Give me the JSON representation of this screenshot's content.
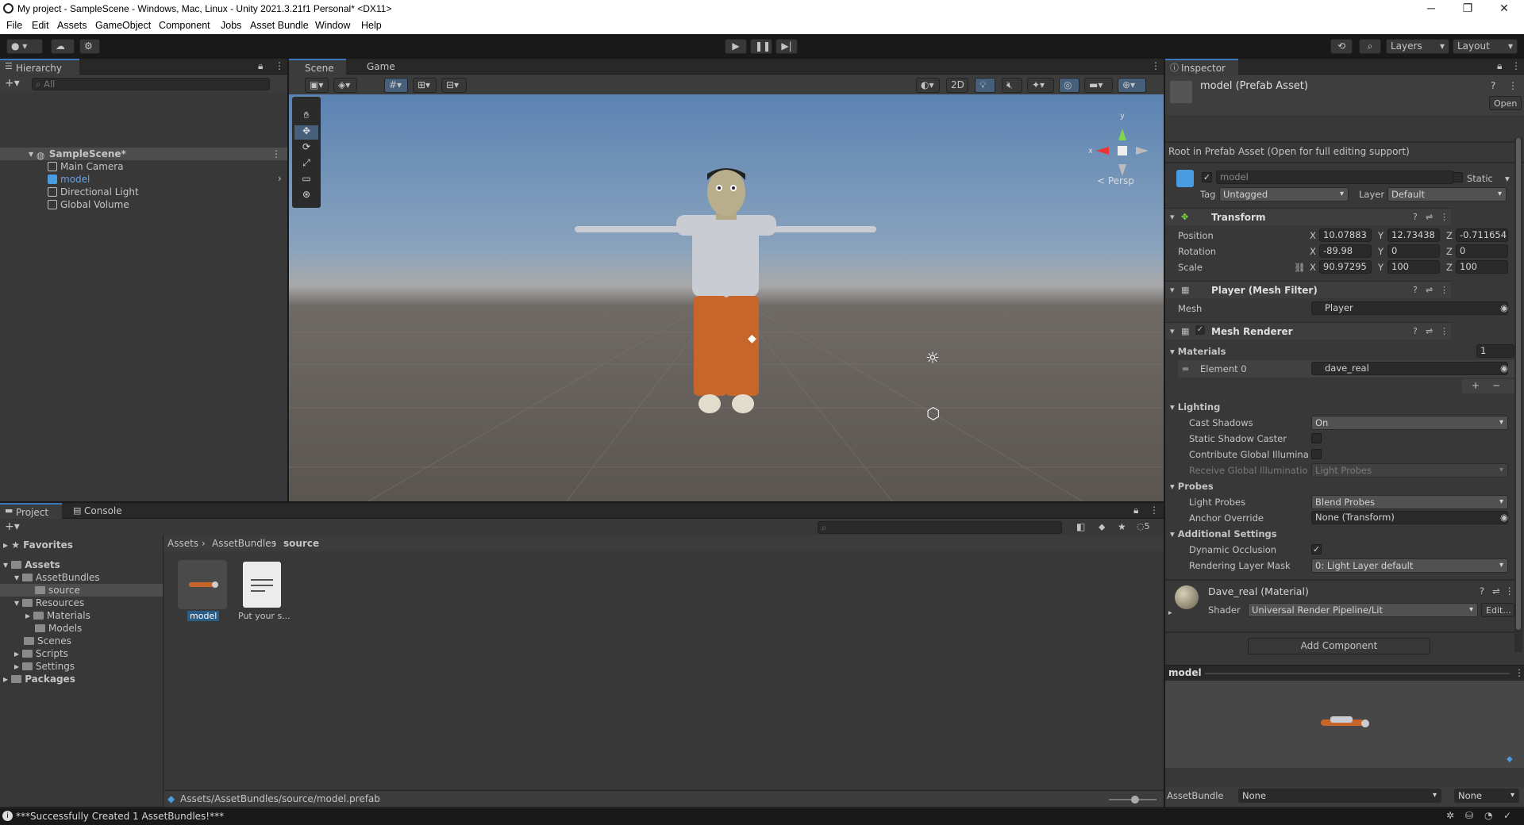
{
  "window": {
    "title": "My project - SampleScene - Windows, Mac, Linux - Unity 2021.3.21f1 Personal* <DX11>"
  },
  "menu": [
    "File",
    "Edit",
    "Assets",
    "GameObject",
    "Component",
    "Jobs",
    "Asset Bundle",
    "Window",
    "Help"
  ],
  "toolbar": {
    "layers": "Layers",
    "layout": "Layout"
  },
  "hierarchy": {
    "tab": "Hierarchy",
    "search_placeholder": "All",
    "scene": "SampleScene*",
    "items": [
      "Main Camera",
      "model",
      "Directional Light",
      "Global Volume"
    ]
  },
  "scene_view": {
    "tabs": [
      "Scene",
      "Game"
    ],
    "mode_2d": "2D",
    "persp": "< Persp",
    "axes": {
      "x": "x",
      "y": "y"
    }
  },
  "project": {
    "tabs": [
      "Project",
      "Console"
    ],
    "favorites": "Favorites",
    "assets": "Assets",
    "asset_bundles": "AssetBundles",
    "source": "source",
    "resources": "Resources",
    "materials": "Materials",
    "models": "Models",
    "scenes": "Scenes",
    "scripts": "Scripts",
    "settings": "Settings",
    "packages": "Packages",
    "breadcrumb": [
      "Assets",
      "AssetBundles",
      "source"
    ],
    "files": [
      {
        "name": "model"
      },
      {
        "name": "Put your s..."
      }
    ],
    "count": "5",
    "path": "Assets/AssetBundles/source/model.prefab"
  },
  "inspector": {
    "tab": "Inspector",
    "title": "model (Prefab Asset)",
    "open": "Open",
    "note": "Root in Prefab Asset (Open for full editing support)",
    "name": "model",
    "static": "Static",
    "tag_label": "Tag",
    "tag": "Untagged",
    "layer_label": "Layer",
    "layer": "Default",
    "transform": {
      "title": "Transform",
      "position_label": "Position",
      "rotation_label": "Rotation",
      "scale_label": "Scale",
      "position": {
        "x": "10.07883",
        "y": "12.73438",
        "z": "-0.711654"
      },
      "rotation": {
        "x": "-89.98",
        "y": "0",
        "z": "0"
      },
      "scale": {
        "x": "90.97295",
        "y": "100",
        "z": "100"
      }
    },
    "axis": {
      "x": "X",
      "y": "Y",
      "z": "Z"
    },
    "mesh_filter": {
      "title": "Player (Mesh Filter)",
      "mesh_label": "Mesh",
      "mesh": "Player"
    },
    "mesh_renderer": {
      "title": "Mesh Renderer",
      "materials_label": "Materials",
      "materials_count": "1",
      "element0_label": "Element 0",
      "element0": "dave_real",
      "lighting": "Lighting",
      "cast_shadows_label": "Cast Shadows",
      "cast_shadows": "On",
      "static_shadow_label": "Static Shadow Caster",
      "contribute_gi_label": "Contribute Global Illuminat",
      "receive_gi_label": "Receive Global Illuminatio",
      "receive_gi": "Light Probes",
      "probes": "Probes",
      "light_probes_label": "Light Probes",
      "light_probes": "Blend Probes",
      "anchor_label": "Anchor Override",
      "anchor": "None (Transform)",
      "additional": "Additional Settings",
      "dyn_occ_label": "Dynamic Occlusion",
      "rlm_label": "Rendering Layer Mask",
      "rlm": "0: Light Layer default"
    },
    "material": {
      "title": "Dave_real (Material)",
      "shader_label": "Shader",
      "shader": "Universal Render Pipeline/Lit",
      "edit": "Edit..."
    },
    "add_component": "Add Component",
    "preview_title": "model",
    "assetbundle_label": "AssetBundle",
    "assetbundle": "None",
    "variant": "None"
  },
  "status": {
    "message": "***Successfully Created 1 AssetBundles!***"
  }
}
